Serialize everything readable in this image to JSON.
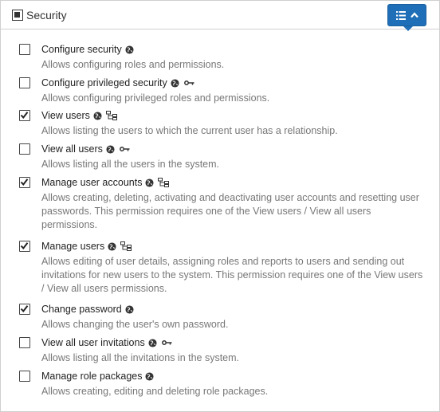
{
  "section": {
    "title": "Security",
    "header_checkbox_state": "indeterminate"
  },
  "colors": {
    "accent": "#1f6fb8",
    "text": "#222222",
    "description": "#777777"
  },
  "permissions": [
    {
      "label": "Configure security",
      "checked": false,
      "icons": [
        "globe-icon"
      ],
      "description": "Allows configuring roles and permissions."
    },
    {
      "label": "Configure privileged security",
      "checked": false,
      "icons": [
        "globe-icon",
        "key-icon"
      ],
      "description": "Allows configuring privileged roles and permissions."
    },
    {
      "label": "View users",
      "checked": true,
      "icons": [
        "globe-icon",
        "hierarchy-icon"
      ],
      "description": "Allows listing the users to which the current user has a relationship."
    },
    {
      "label": "View all users",
      "checked": false,
      "icons": [
        "globe-icon",
        "key-icon"
      ],
      "description": "Allows listing all the users in the system."
    },
    {
      "label": "Manage user accounts",
      "checked": true,
      "icons": [
        "globe-icon",
        "hierarchy-icon"
      ],
      "description": "Allows creating, deleting, activating and deactivating user accounts and resetting user passwords. This permission requires one of the View users / View all users permissions."
    },
    {
      "label": "Manage users",
      "checked": true,
      "icons": [
        "globe-icon",
        "hierarchy-icon"
      ],
      "description": "Allows editing of user details, assigning roles and reports to users and sending out invitations for new users to the system. This permission requires one of the View users / View all users permissions."
    },
    {
      "label": "Change password",
      "checked": true,
      "icons": [
        "globe-icon"
      ],
      "description": "Allows changing the user's own password."
    },
    {
      "label": "View all user invitations",
      "checked": false,
      "icons": [
        "globe-icon",
        "key-icon"
      ],
      "description": "Allows listing all the invitations in the system."
    },
    {
      "label": "Manage role packages",
      "checked": false,
      "icons": [
        "globe-icon"
      ],
      "description": "Allows creating, editing and deleting role packages."
    }
  ]
}
